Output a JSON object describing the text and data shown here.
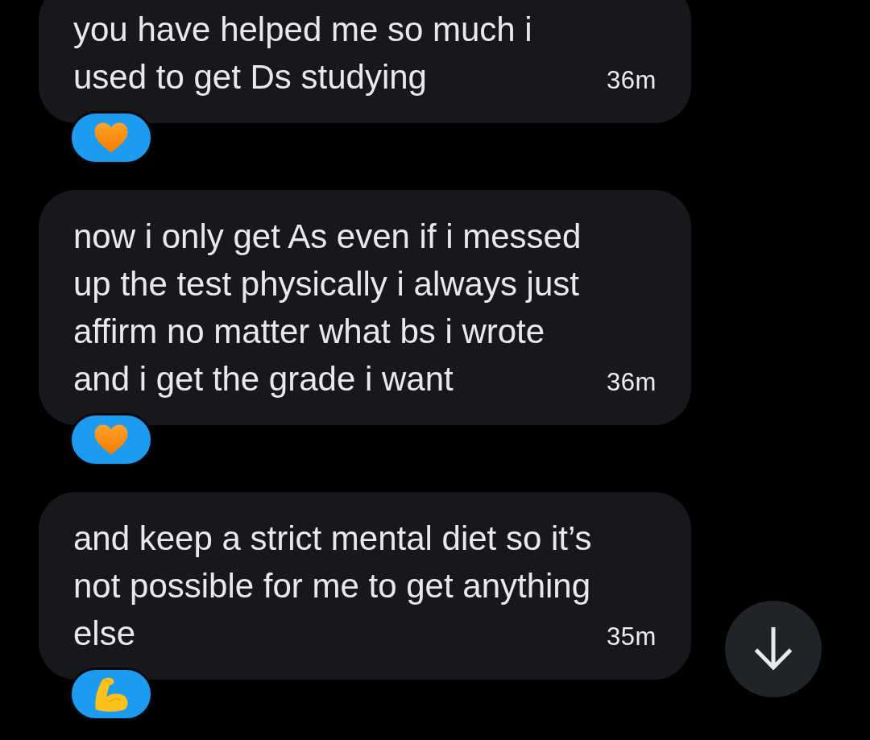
{
  "messages": [
    {
      "text": "you have helped me so much i used to get Ds studying",
      "time": "36m",
      "reaction": {
        "kind": "heart",
        "selected": true
      }
    },
    {
      "text": "now i only get As even if i messed up the test physically i always just affirm no matter what bs i wrote and i get the grade i want",
      "time": "36m",
      "reaction": {
        "kind": "heart",
        "selected": true
      }
    },
    {
      "text": "and keep a strict mental diet so it’s not possible for me to get anything else",
      "time": "35m",
      "reaction": {
        "kind": "flexed_arm",
        "selected": true
      }
    }
  ]
}
